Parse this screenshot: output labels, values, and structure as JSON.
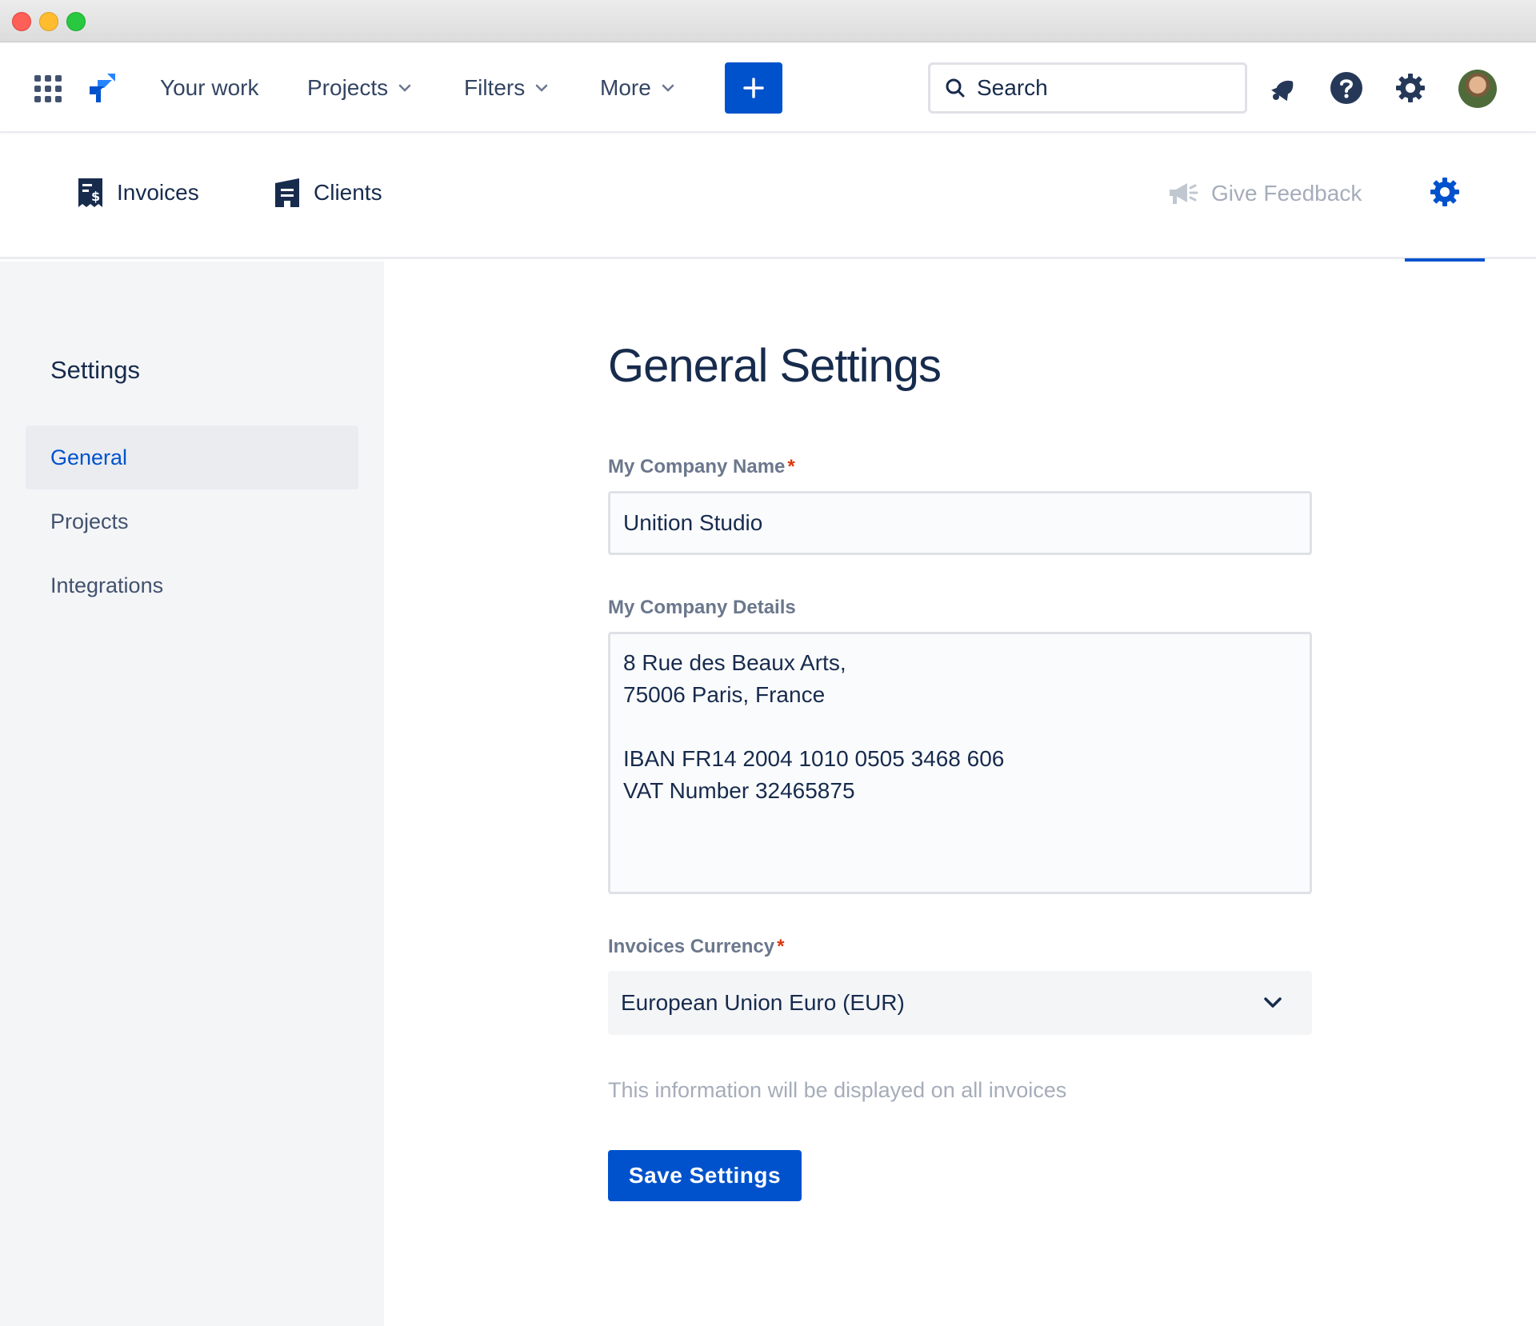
{
  "topnav": {
    "items": [
      {
        "label": "Your work",
        "has_dropdown": false
      },
      {
        "label": "Projects",
        "has_dropdown": true
      },
      {
        "label": "Filters",
        "has_dropdown": true
      },
      {
        "label": "More",
        "has_dropdown": true
      }
    ],
    "create_icon": "plus-icon",
    "search": {
      "placeholder": "Search",
      "icon": "search-icon"
    },
    "icons": [
      "notifications-icon",
      "help-icon",
      "settings-icon"
    ],
    "accent_color": "#0052cc"
  },
  "subnav": {
    "invoices_label": "Invoices",
    "clients_label": "Clients",
    "feedback_label": "Give Feedback"
  },
  "sidebar": {
    "title": "Settings",
    "items": [
      {
        "label": "General",
        "active": true
      },
      {
        "label": "Projects",
        "active": false
      },
      {
        "label": "Integrations",
        "active": false
      }
    ]
  },
  "main": {
    "title": "General Settings",
    "company_name": {
      "label": "My Company Name",
      "required_mark": "*",
      "value": "Unition Studio"
    },
    "company_details": {
      "label": "My Company Details",
      "value": "8 Rue des Beaux Arts,\n75006 Paris, France\n\nIBAN FR14 2004 1010 0505 3468 606\nVAT Number 32465875"
    },
    "currency": {
      "label": "Invoices Currency",
      "required_mark": "*",
      "value": "European Union Euro (EUR)"
    },
    "helper_text": "This information will be displayed on all invoices",
    "save_label": "Save Settings"
  }
}
